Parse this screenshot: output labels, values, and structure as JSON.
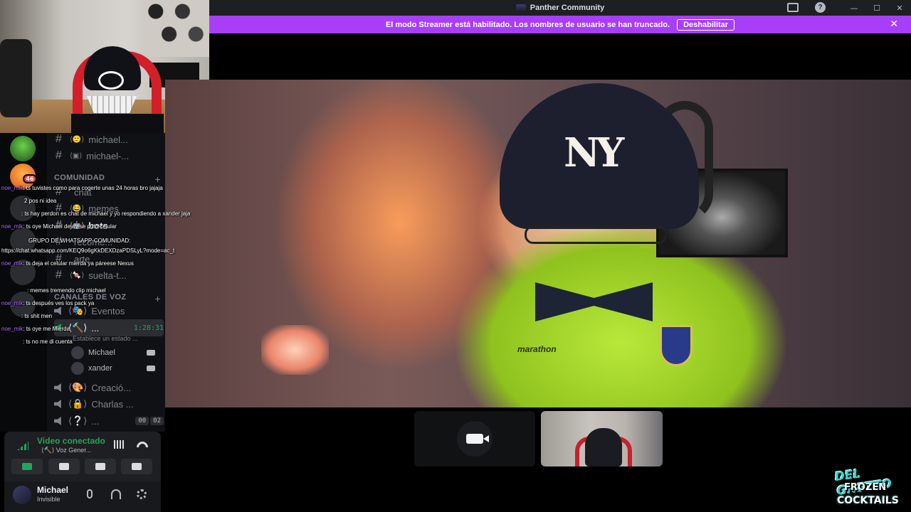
{
  "window": {
    "title": "Panther Community",
    "controls": {
      "minimize": "—",
      "maximize": "☐",
      "close": "✕"
    }
  },
  "banner": {
    "message": "El modo Streamer está habilitado. Los nombres de usuario se han truncado.",
    "button_label": "Deshabilitar",
    "close_glyph": "✕",
    "color": "#a73ff8"
  },
  "servers": [
    {
      "badge": ""
    },
    {
      "badge": "46"
    }
  ],
  "channels": {
    "top": [
      {
        "emoji": "⟨🙂⟩",
        "name": "michael..."
      },
      {
        "emoji": "⟨▣⟩",
        "name": "michael-..."
      }
    ],
    "community_category": "COMUNIDAD",
    "community": [
      {
        "emoji": "",
        "name": "chat"
      },
      {
        "emoji": "⟨😂⟩",
        "name": "memes"
      },
      {
        "emoji": "⟨🤖⟩",
        "name": "bots",
        "active": true
      },
      {
        "emoji": "",
        "name": "recome..."
      },
      {
        "emoji": "",
        "name": "arte"
      },
      {
        "emoji": "⟨🍬⟩",
        "name": "suelta-t..."
      }
    ],
    "voice_category": "CANALES DE VOZ",
    "voice": [
      {
        "emoji": "⟨🎭⟩",
        "name": "Eventos"
      },
      {
        "emoji": "⟨🔨⟩",
        "name": "...",
        "timer": "1:28:31",
        "status": "Establece un estado ...",
        "users": [
          "Michael",
          "xander"
        ]
      },
      {
        "emoji": "⟨🎨⟩",
        "name": "Creació..."
      },
      {
        "emoji": "⟨🔒⟩",
        "name": "Charlas ..."
      },
      {
        "emoji": "⟨❔⟩",
        "name": "...",
        "counts": [
          "00",
          "02"
        ]
      }
    ]
  },
  "chat_overlay": [
    {
      "user": "noe_mik",
      "text": ": ts tuvistes como para cogerte unas 24 horas bro jajaja"
    },
    {
      "user": "",
      "text": "2 pos ni idea"
    },
    {
      "user": "",
      "text": ": ts hay perdon es chat de michael y yo respondiendo a xander jaja"
    },
    {
      "user": "noe_mik",
      "text": ": ts oye Michael deja ese puto celular"
    },
    {
      "user": "",
      "text": "GRUPO DE WHATSAPP-COMUNIDAD:"
    },
    {
      "user": "",
      "text": "https://chat.whatsapp.com/KEQ9o6gKkDEXDzaPDSLyL?mode=ac_t"
    },
    {
      "user": "noe_mik",
      "text": ": ts deja el celular mierda ya páreese Nexus"
    },
    {
      "user": "",
      "text": ": memes tremendo clip michael"
    },
    {
      "user": "noe_mik",
      "text": ": ts después ves los pack ya"
    },
    {
      "user": "",
      "text": ": ts shit men"
    },
    {
      "user": "noe_mik",
      "text": ": ts oye me Mierda"
    },
    {
      "user": "",
      "text": ": ts no me di cuenta"
    }
  ],
  "voice_panel": {
    "title": "Video conectado",
    "subtitle": "⟨🔨⟩ Voz Gener...",
    "accent": "#23a559"
  },
  "user_panel": {
    "name": "Michael",
    "status": "Invisible"
  },
  "branding": {
    "line1": "DEL GHETTO",
    "line2": "FROZEN",
    "line3": "COCKTAILS"
  }
}
